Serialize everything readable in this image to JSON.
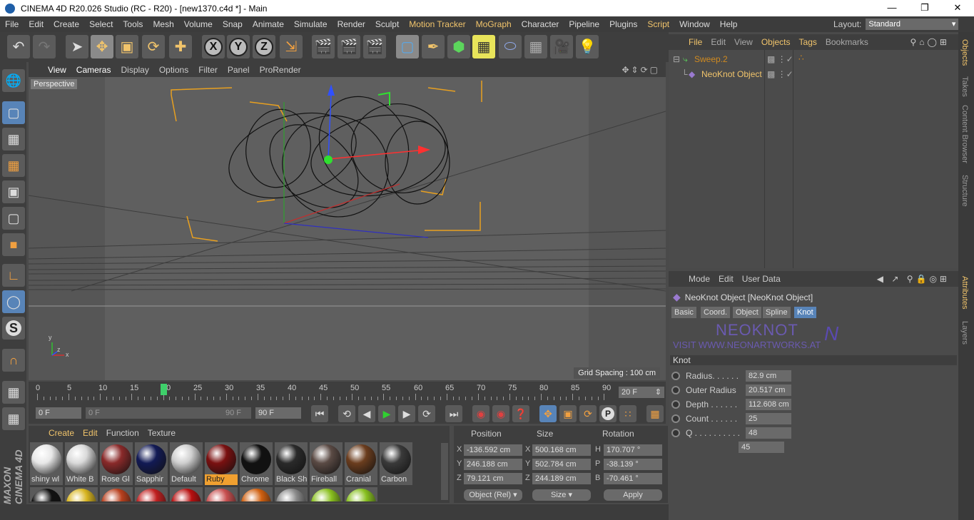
{
  "window": {
    "title": "CINEMA 4D R20.026 Studio (RC - R20) - [new1370.c4d *] - Main"
  },
  "menubar": {
    "items": [
      "File",
      "Edit",
      "Create",
      "Select",
      "Tools",
      "Mesh",
      "Volume",
      "Snap",
      "Animate",
      "Simulate",
      "Render",
      "Sculpt",
      "Motion Tracker",
      "MoGraph",
      "Character",
      "Pipeline",
      "Plugins",
      "Script",
      "Window",
      "Help"
    ],
    "layout_label": "Layout:",
    "layout_value": "Standard"
  },
  "toolbar": {
    "x_label": "X",
    "y_label": "Y",
    "z_label": "Z"
  },
  "viewport": {
    "menu": [
      "View",
      "Cameras",
      "Display",
      "Options",
      "Filter",
      "Panel",
      "ProRender"
    ],
    "camera_label": "Perspective",
    "grid_spacing": "Grid Spacing : 100 cm",
    "axis_x": "x",
    "axis_y": "y",
    "axis_z": "z"
  },
  "timeline": {
    "ticks": [
      "0",
      "5",
      "10",
      "15",
      "20",
      "25",
      "30",
      "35",
      "40",
      "45",
      "50",
      "55",
      "60",
      "65",
      "70",
      "75",
      "80",
      "85",
      "90"
    ],
    "current_frame": "20 F",
    "current_value": 20,
    "max_frame": 90
  },
  "playback": {
    "start": "0 F",
    "range_start": "0 F",
    "range_end": "90 F",
    "end": "90 F"
  },
  "materials": {
    "menu": [
      "Create",
      "Edit",
      "Function",
      "Texture"
    ],
    "items": [
      {
        "name": "shiny wl",
        "color": "#e8e8e8"
      },
      {
        "name": "White B",
        "color": "#d9d9d9"
      },
      {
        "name": "Rose Gl",
        "color": "#8a2a2a"
      },
      {
        "name": "Sapphir",
        "color": "#121a55"
      },
      {
        "name": "Default",
        "color": "#cfcfcf"
      },
      {
        "name": "Ruby",
        "color": "#7a1010"
      },
      {
        "name": "Chrome",
        "color": "#111111"
      },
      {
        "name": "Black Sh",
        "color": "#2a2a2a"
      },
      {
        "name": "Fireball",
        "color": "#5a4a44"
      },
      {
        "name": "Cranial",
        "color": "#6b3d1e"
      },
      {
        "name": "Carbon",
        "color": "#3a3a3a"
      }
    ],
    "row2_colors": [
      "#111111",
      "#d8b520",
      "#b8401e",
      "#c02020",
      "#b81010",
      "#c85050",
      "#d06010",
      "#8a8a8a",
      "#8ac020",
      "#88c020"
    ],
    "brand": "MAXON CINEMA 4D"
  },
  "coords": {
    "headers": {
      "position": "Position",
      "size": "Size",
      "rotation": "Rotation"
    },
    "rows": [
      {
        "axis": "X",
        "pos": "-136.592 cm",
        "size_axis": "X",
        "size": "500.168 cm",
        "rot_axis": "H",
        "rot": "170.707 °"
      },
      {
        "axis": "Y",
        "pos": "246.188 cm",
        "size_axis": "Y",
        "size": "502.784 cm",
        "rot_axis": "P",
        "rot": "-38.139 °"
      },
      {
        "axis": "Z",
        "pos": "79.121 cm",
        "size_axis": "Z",
        "size": "244.189 cm",
        "rot_axis": "B",
        "rot": "-70.461 °"
      }
    ],
    "mode": "Object (Rel)",
    "size_mode": "Size",
    "apply": "Apply"
  },
  "objects": {
    "menu": [
      "File",
      "Edit",
      "View",
      "Objects",
      "Tags",
      "Bookmarks"
    ],
    "tree": [
      {
        "name": "Sweep.2",
        "color": "#d08a20"
      },
      {
        "name": "NeoKnot Object",
        "color": "#f1c46b"
      }
    ]
  },
  "attributes": {
    "menu": [
      "Mode",
      "Edit",
      "User Data"
    ],
    "object_title": "NeoKnot Object [NeoKnot Object]",
    "tabs": [
      "Basic",
      "Coord.",
      "Object",
      "Spline",
      "Knot"
    ],
    "active_tab": "Knot",
    "banner_title": "NEOKNOT",
    "banner_sub": "VISIT WWW.NEONARTWORKS.AT",
    "section": "Knot",
    "params": [
      {
        "label": "Radius. . . . . .",
        "value": "82.9 cm"
      },
      {
        "label": "Outer Radius",
        "value": "20.517 cm"
      },
      {
        "label": "Depth . . . . . .",
        "value": "112.608 cm"
      },
      {
        "label": "Count . . . . . .",
        "value": "25"
      },
      {
        "label": "Q . . . . . . . . . .",
        "value": "48"
      }
    ],
    "extra_value": "45"
  },
  "side_tabs": [
    "Objects",
    "Takes",
    "Content Browser",
    "Structure",
    "Attributes",
    "Layers"
  ]
}
